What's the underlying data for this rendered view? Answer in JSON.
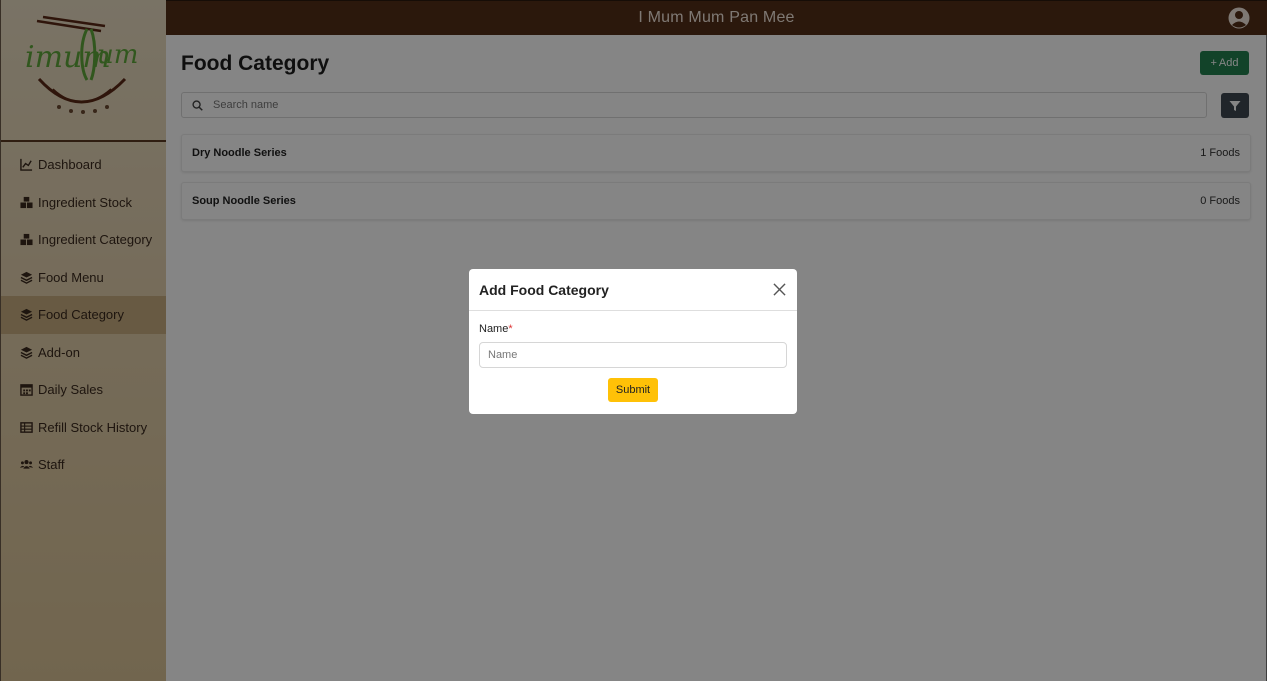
{
  "app": {
    "title": "I Mum Mum Pan Mee"
  },
  "colors": {
    "topbar": "#542e17",
    "accent_green": "#23804f",
    "submit_yellow": "#ffc107",
    "sidebar_active": "#c7ad80"
  },
  "sidebar": {
    "items": [
      {
        "label": "Dashboard",
        "icon": "chart-line-icon"
      },
      {
        "label": "Ingredient Stock",
        "icon": "cubes-icon"
      },
      {
        "label": "Ingredient Category",
        "icon": "cubes-icon"
      },
      {
        "label": "Food Menu",
        "icon": "layer-group-icon"
      },
      {
        "label": "Food Category",
        "icon": "layer-group-icon",
        "active": true
      },
      {
        "label": "Add-on",
        "icon": "layer-group-icon"
      },
      {
        "label": "Daily Sales",
        "icon": "calendar-icon"
      },
      {
        "label": "Refill Stock History",
        "icon": "table-icon"
      },
      {
        "label": "Staff",
        "icon": "users-icon"
      }
    ]
  },
  "main": {
    "page_title": "Food Category",
    "add_label": "Add",
    "search_placeholder": "Search name",
    "categories": [
      {
        "name": "Dry Noodle Series",
        "count": "1 Foods"
      },
      {
        "name": "Soup Noodle Series",
        "count": "0 Foods"
      }
    ]
  },
  "modal": {
    "title": "Add Food Category",
    "field_label": "Name",
    "required_mark": "*",
    "input_placeholder": "Name",
    "input_value": "",
    "submit_label": "Submit"
  }
}
